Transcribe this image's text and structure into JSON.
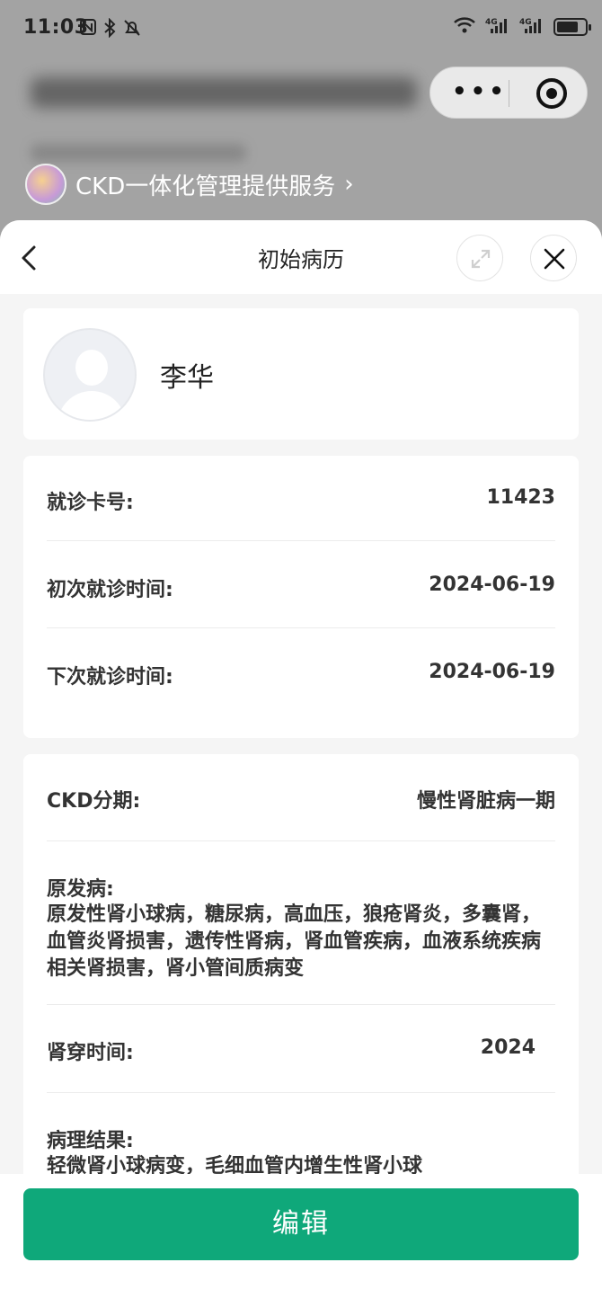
{
  "status_bar": {
    "time": "11:03",
    "left_icons": [
      "nfc-icon",
      "bluetooth-icon",
      "mute-bell-icon"
    ],
    "network": [
      "wifi-icon",
      "4G",
      "4G"
    ],
    "battery_level": 0.75
  },
  "mini_program": {
    "service_text": "CKD一体化管理提供服务",
    "service_chevron": "›"
  },
  "sheet": {
    "title": "初始病历"
  },
  "profile": {
    "name": "李华"
  },
  "visit": {
    "card_no_label": "就诊卡号:",
    "card_no_value": "11423",
    "first_visit_label": "初次就诊时间:",
    "first_visit_value": "2024-06-19",
    "next_visit_label": "下次就诊时间:",
    "next_visit_value": "2024-06-19"
  },
  "diagnosis": {
    "ckd_stage_label": "CKD分期:",
    "ckd_stage_value": "慢性肾脏病一期",
    "primary_disease_label": "原发病:",
    "primary_disease_value": "原发性肾小球病，糖尿病，高血压，狼疮肾炎，多囊肾，血管炎肾损害，遗传性肾病，肾血管疾病，血液系统疾病相关肾损害，肾小管间质病变",
    "biopsy_time_label": "肾穿时间:",
    "biopsy_time_value": "2024",
    "pathology_label": "病理结果:",
    "pathology_value": "轻微肾小球病变，毛细血管内增生性肾小球"
  },
  "actions": {
    "edit_label": "编辑"
  },
  "colors": {
    "accent": "#0fa87a",
    "sheet_bg": "#f5f5f5",
    "overlay_bg": "#a3a3a3"
  }
}
